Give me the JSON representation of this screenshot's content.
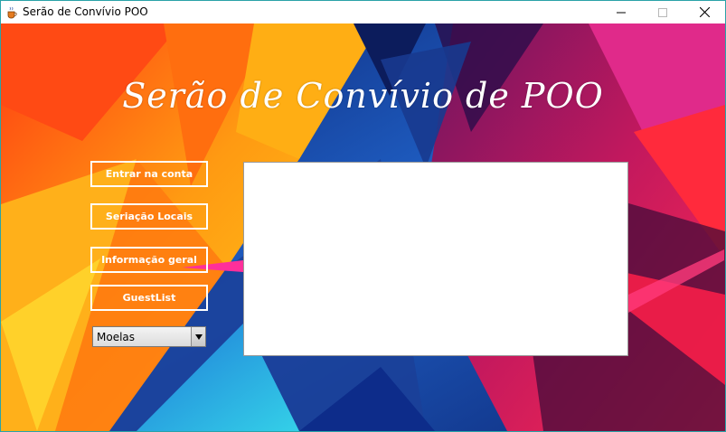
{
  "window": {
    "title": "Serão de Convívio POO",
    "icon": "java-cup-icon",
    "border_color": "#2aa3a8"
  },
  "main": {
    "heading": "Serão de Convívio de POO",
    "buttons": [
      {
        "label": "Entrar na conta"
      },
      {
        "label": "Seriação Locais"
      },
      {
        "label": "Informação geral"
      },
      {
        "label": "GuestList"
      }
    ],
    "dropdown": {
      "selected": "Moelas"
    }
  },
  "colors": {
    "orange": "#ff8c0a",
    "blue": "#1e4fa8",
    "magenta": "#d81f6a",
    "red": "#e8263a"
  }
}
